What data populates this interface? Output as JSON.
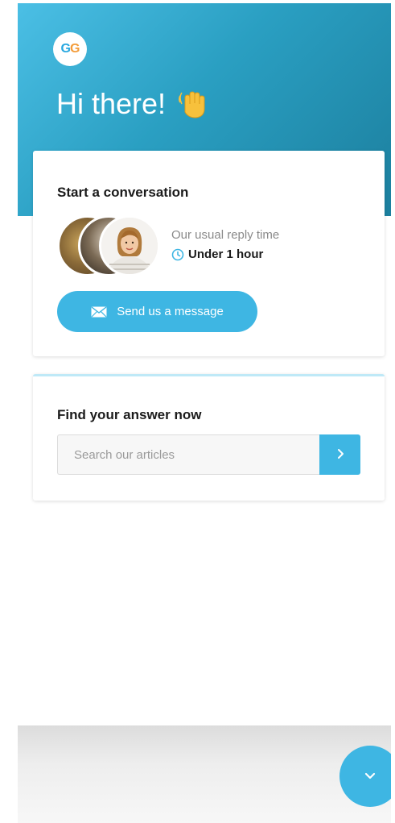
{
  "brand": {
    "logo_text": "GG",
    "accent_color": "#3eb6e3"
  },
  "header": {
    "greeting": "Hi there!",
    "greeting_icon": "waving-hand-icon"
  },
  "conversation_card": {
    "title": "Start a conversation",
    "reply_label": "Our usual reply time",
    "reply_time": "Under 1 hour",
    "reply_icon": "clock-icon",
    "send_button_label": "Send us a message",
    "send_button_icon": "envelope-icon"
  },
  "find_card": {
    "title": "Find your answer now",
    "search_placeholder": "Search our articles",
    "search_button_icon": "chevron-right-icon"
  },
  "launcher": {
    "icon": "chevron-down-icon"
  }
}
